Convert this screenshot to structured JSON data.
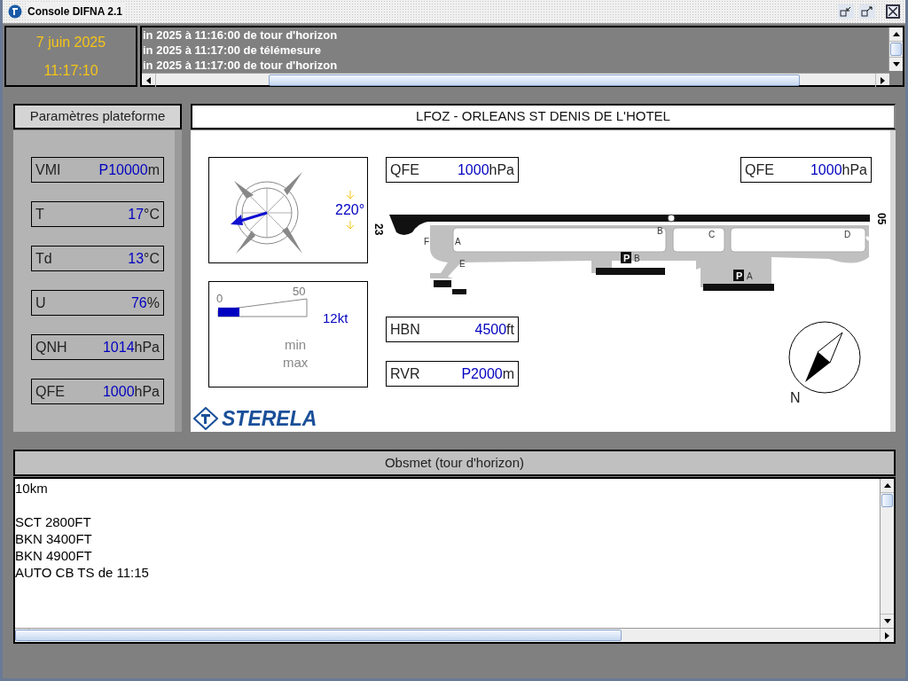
{
  "window": {
    "title": "Console DIFNA 2.1"
  },
  "clock": {
    "date": "7 juin 2025",
    "time": "11:17:10"
  },
  "log": [
    "in 2025 à 11:16:00 de tour d'horizon",
    "in 2025 à 11:17:00 de télémesure",
    "in 2025 à 11:17:00 de tour d'horizon"
  ],
  "platform": {
    "title": "Paramètres plateforme",
    "params": [
      {
        "label": "VMI",
        "value": "P10000",
        "unit": "m"
      },
      {
        "label": "T",
        "value": "17",
        "unit": "°C"
      },
      {
        "label": "Td",
        "value": "13",
        "unit": "°C"
      },
      {
        "label": "U",
        "value": "76",
        "unit": "%"
      },
      {
        "label": "QNH",
        "value": "1014",
        "unit": "hPa"
      },
      {
        "label": "QFE",
        "value": "1000",
        "unit": "hPa"
      }
    ]
  },
  "airport": {
    "title": "LFOZ - ORLEANS ST DENIS DE L'HOTEL",
    "wind_direction": "220°",
    "wind_speed": {
      "scale_min": "0",
      "scale_max": "50",
      "level": 0.24,
      "reading": "12kt",
      "min_label": "min",
      "max_label": "max"
    },
    "qfe_left": {
      "label": "QFE",
      "value": "1000",
      "unit": "hPa"
    },
    "qfe_right": {
      "label": "QFE",
      "value": "1000",
      "unit": "hPa"
    },
    "hbn": {
      "label": "HBN",
      "value": "4500",
      "unit": "ft"
    },
    "rvr": {
      "label": "RVR",
      "value": "P2000",
      "unit": "m"
    },
    "runway_ends": [
      "23",
      "05"
    ],
    "taxiways": [
      "A",
      "B",
      "C",
      "D",
      "E",
      "F"
    ],
    "parkings": [
      {
        "sign": "P",
        "name": "B"
      },
      {
        "sign": "P",
        "name": "A"
      }
    ],
    "north": "N",
    "logo": "STERELA"
  },
  "obsmet": {
    "title": "Obsmet (tour d'horizon)",
    "paragraphs": [
      [
        "10km"
      ],
      [
        "SCT 2800FT",
        "BKN 3400FT",
        "BKN 4900FT",
        "AUTO CB TS de 11:15"
      ]
    ]
  }
}
